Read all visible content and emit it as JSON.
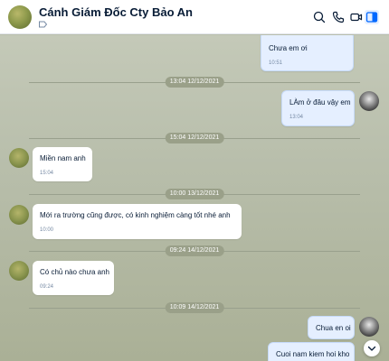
{
  "header": {
    "title": "Cánh Giám Đốc Cty Bảo An",
    "icons": [
      "search-icon",
      "phone-icon",
      "video-icon",
      "sidebar-toggle-icon"
    ]
  },
  "messages": [
    {
      "dir": "out",
      "text": "Chưa em ơi",
      "time": "10:51"
    },
    {
      "dir": "out",
      "text": "LÀm ở đâu vậy em",
      "time": "13:04"
    },
    {
      "dir": "in",
      "text": "Miền nam anh",
      "time": "15:04"
    },
    {
      "dir": "in",
      "text": "Mới ra trường cũng được, có kinh nghiệm càng tốt nhé anh",
      "time": "10:00"
    },
    {
      "dir": "in",
      "text": "Có chủ nào chưa anh",
      "time": "09:24"
    },
    {
      "dir": "out",
      "text": "Chua en oi",
      "time": ""
    },
    {
      "dir": "out",
      "text": "Cuoi nam kiem hoi kho",
      "time": ""
    }
  ],
  "separators": [
    "13:04 12/12/2021",
    "15:04 12/12/2021",
    "10:00 13/12/2021",
    "09:24 14/12/2021",
    "10:09 14/12/2021"
  ],
  "colors": {
    "accent": "#0068ff",
    "outgoing_bubble": "#e5efff",
    "incoming_bubble": "#ffffff"
  }
}
